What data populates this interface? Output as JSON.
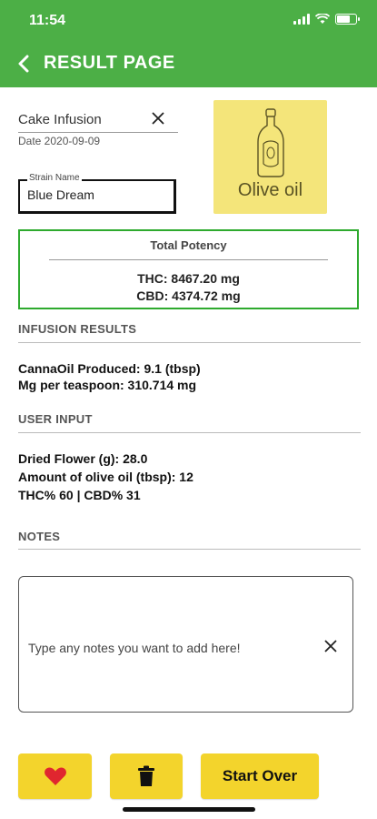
{
  "status_bar": {
    "time": "11:54"
  },
  "header": {
    "title": "RESULT PAGE"
  },
  "recipe": {
    "name": "Cake Infusion",
    "date": "Date 2020-09-09"
  },
  "strain": {
    "label": "Strain Name",
    "value": "Blue Dream"
  },
  "oil_card": {
    "label": "Olive oil",
    "color": "#f4e57a"
  },
  "potency": {
    "title": "Total Potency",
    "thc": "THC: 8467.20 mg",
    "cbd": "CBD: 4374.72 mg",
    "border_color": "#2eaa2e"
  },
  "infusion_results": {
    "heading": "INFUSION RESULTS",
    "lines": [
      "CannaOil Produced: 9.1 (tbsp)",
      "Mg per teaspoon: 310.714 mg"
    ]
  },
  "user_input": {
    "heading": "USER INPUT",
    "lines": [
      "Dried Flower (g): 28.0",
      "Amount of olive oil (tbsp): 12",
      "THC% 60 | CBD% 31"
    ]
  },
  "notes": {
    "heading": "NOTES",
    "placeholder": "Type any notes you want to add here!"
  },
  "buttons": {
    "start_over": "Start Over",
    "accent_color": "#f3d42c",
    "favorite_icon": "heart-icon",
    "delete_icon": "trash-icon"
  },
  "theme": {
    "header_color": "#4caf46"
  }
}
